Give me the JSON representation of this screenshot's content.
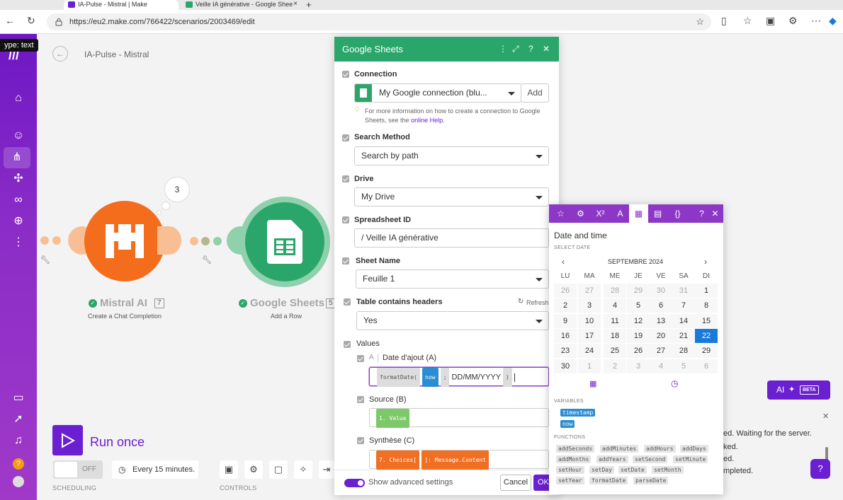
{
  "browser": {
    "tabs": [
      {
        "title": "IA-Pulse - Mistral | Make"
      },
      {
        "title": "Veille IA générative - Google Shee"
      }
    ],
    "url": "https://eu2.make.com/766422/scenarios/2003469/edit",
    "tooltip": "ype: text"
  },
  "scenario": {
    "name": "IA-Pulse - Mistral",
    "bubble_count": "3"
  },
  "modules": [
    {
      "name": "Mistral AI",
      "number": "7",
      "action": "Create a Chat Completion",
      "color": "#f46d1c"
    },
    {
      "name": "Google Sheets",
      "number": "5",
      "action": "Add a Row",
      "color": "#2aa66a"
    }
  ],
  "run": {
    "label": "Run once",
    "toggle": "OFF",
    "schedule": "Every 15 minutes.",
    "scheduling_caption": "SCHEDULING",
    "controls_caption": "CONTROLS"
  },
  "panel": {
    "title": "Google Sheets",
    "connection_label": "Connection",
    "connection_value": "My Google connection (blu...",
    "add_label": "Add",
    "help_text": "For more information on how to create a connection to Google Sheets, see the",
    "help_link": "online Help.",
    "search_method_label": "Search Method",
    "search_method_value": "Search by path",
    "drive_label": "Drive",
    "drive_value": "My Drive",
    "spreadsheet_label": "Spreadsheet ID",
    "spreadsheet_value": "/ Veille IA générative",
    "sheet_label": "Sheet Name",
    "sheet_value": "Feuille 1",
    "headers_label": "Table contains headers",
    "refresh_label": "Refresh",
    "headers_value": "Yes",
    "values_label": "Values",
    "col_a_label": "Date d'ajout (A)",
    "formula_fn": "formatDate(",
    "formula_now": "now",
    "formula_sep": ";",
    "formula_format": "DD/MM/YYYY",
    "formula_close": ")",
    "col_b_label": "Source (B)",
    "col_b_value": "1. Value",
    "col_c_label": "Synthèse (C)",
    "col_c_value1": "7. Choices[",
    "col_c_value2": "]: Message.Content",
    "advanced_label": "Show advanced settings",
    "cancel_label": "Cancel",
    "ok_label": "OK"
  },
  "picker": {
    "title": "Date and time",
    "select_date_caption": "SELECT DATE",
    "month": "SEPTEMBRE 2024",
    "weekdays": [
      "LU",
      "MA",
      "ME",
      "JE",
      "VE",
      "SA",
      "DI"
    ],
    "weeks": [
      [
        "26",
        "27",
        "28",
        "29",
        "30",
        "31",
        "1"
      ],
      [
        "2",
        "3",
        "4",
        "5",
        "6",
        "7",
        "8"
      ],
      [
        "9",
        "10",
        "11",
        "12",
        "13",
        "14",
        "15"
      ],
      [
        "16",
        "17",
        "18",
        "19",
        "20",
        "21",
        "22"
      ],
      [
        "23",
        "24",
        "25",
        "26",
        "27",
        "28",
        "29"
      ],
      [
        "30",
        "1",
        "2",
        "3",
        "4",
        "5",
        "6"
      ]
    ],
    "selected_day": "22",
    "variables_caption": "VARIABLES",
    "variables": [
      "timestamp",
      "now"
    ],
    "functions_caption": "FUNCTIONS",
    "functions": [
      "addSeconds",
      "addMinutes",
      "addHours",
      "addDays",
      "addMonths",
      "addYears",
      "setSecond",
      "setMinute",
      "setHour",
      "setDay",
      "setDate",
      "setMonth",
      "setYear",
      "formatDate",
      "parseDate"
    ]
  },
  "ai": {
    "label": "AI",
    "beta": "BETA"
  },
  "log": {
    "lines": [
      "ed. Waiting for the server.",
      "ked.",
      "ed.",
      "mpleted."
    ]
  }
}
